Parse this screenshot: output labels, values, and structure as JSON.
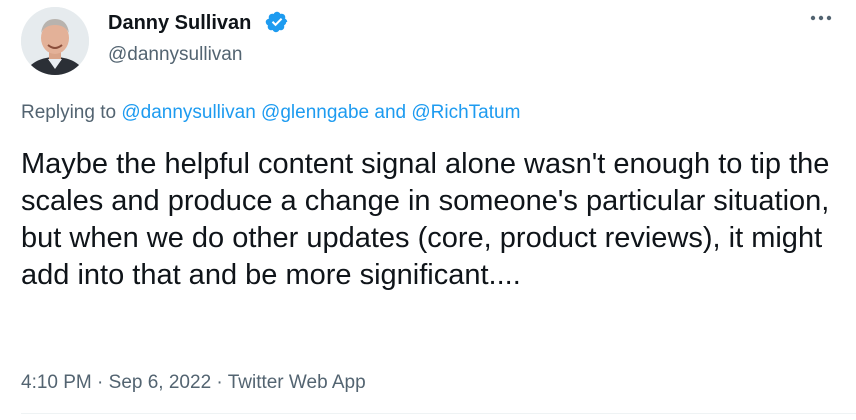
{
  "author": {
    "name": "Danny Sullivan",
    "handle": "@dannysullivan",
    "verified": true,
    "verified_icon": "verified-badge-icon",
    "avatar_icon": "avatar-photo"
  },
  "more_menu_icon": "more-options-icon",
  "reply": {
    "prefix": "Replying to",
    "mentions": [
      "@dannysullivan",
      "@glenngabe",
      "@RichTatum"
    ],
    "conjunction": "and"
  },
  "tweet": {
    "text": "Maybe the helpful content signal alone wasn't enough to tip the scales and produce a change in someone's particular situation, but when we do other updates (core, product reviews), it might add into that and be more significant...."
  },
  "meta": {
    "time": "4:10 PM",
    "date": "Sep 6, 2022",
    "source": "Twitter Web App",
    "separator": "·"
  },
  "colors": {
    "text": "#0f1419",
    "secondary": "#536471",
    "accent": "#1d9bf0"
  }
}
